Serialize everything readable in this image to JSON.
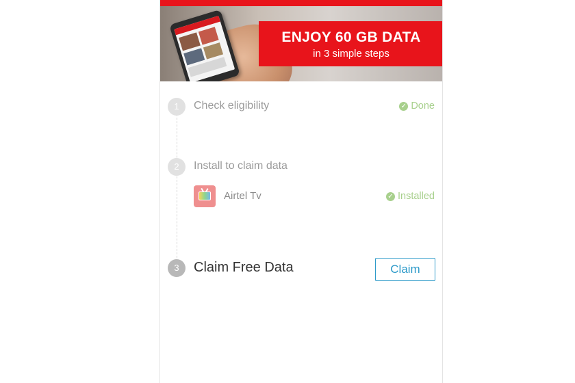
{
  "banner": {
    "title": "ENJOY 60 GB DATA",
    "subtitle": "in 3 simple steps"
  },
  "steps": [
    {
      "number": "1",
      "label": "Check eligibility",
      "status": "Done"
    },
    {
      "number": "2",
      "label": "Install to claim data",
      "app": {
        "name": "Airtel Tv",
        "icon": "tv-icon",
        "status": "Installed"
      }
    },
    {
      "number": "3",
      "label": "Claim Free Data",
      "action_label": "Claim"
    }
  ],
  "colors": {
    "brand_red": "#e8141b",
    "status_green": "#a8d08d",
    "action_blue": "#2d9ac9"
  },
  "icons": {
    "status_done": "check-circle-icon"
  }
}
